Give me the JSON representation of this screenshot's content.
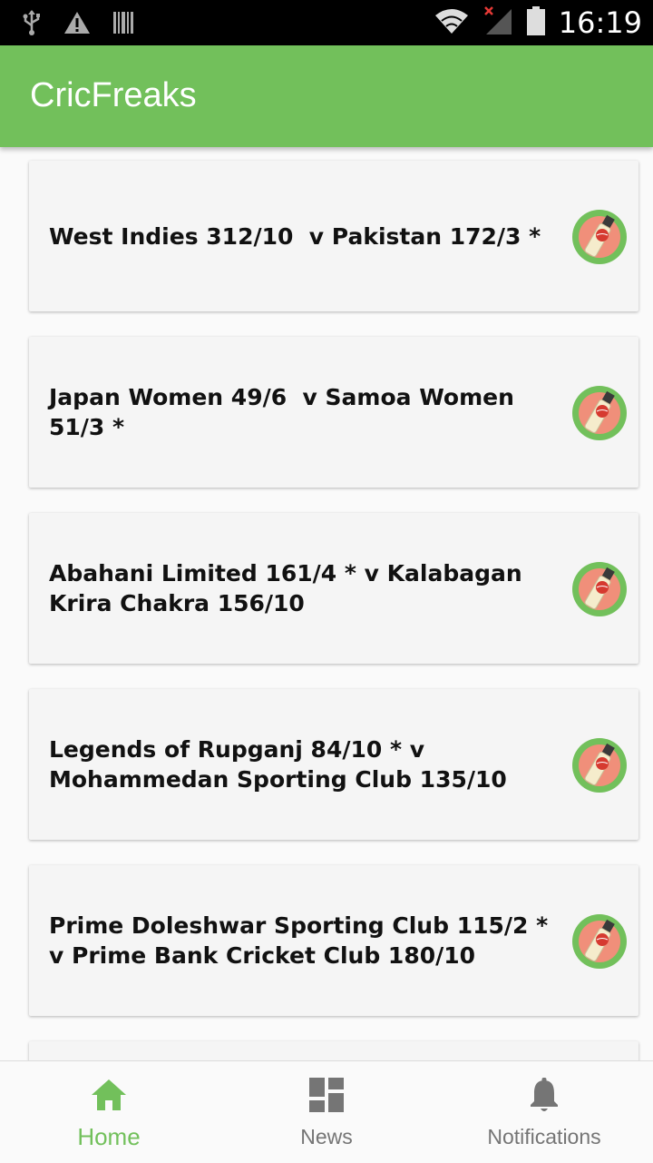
{
  "status_bar": {
    "time": "16:19",
    "icons": [
      "usb-icon",
      "warning-icon",
      "barcode-icon",
      "wifi-icon",
      "signal-icon",
      "battery-icon"
    ]
  },
  "app_bar": {
    "title": "CricFreaks"
  },
  "matches": [
    {
      "text": "West Indies 312/10  v Pakistan 172/3 *"
    },
    {
      "text": "Japan Women 49/6  v Samoa Women 51/3 *"
    },
    {
      "text": "Abahani Limited 161/4 * v Kalabagan Krira Chakra 156/10"
    },
    {
      "text": "Legends of Rupganj 84/10 * v Mohammedan Sporting Club 135/10"
    },
    {
      "text": "Prime Doleshwar Sporting Club 115/2 * v Prime Bank Cricket Club 180/10"
    },
    {
      "text": ""
    }
  ],
  "bottom_nav": {
    "items": [
      {
        "label": "Home",
        "icon": "home-icon",
        "active": true
      },
      {
        "label": "News",
        "icon": "dashboard-icon",
        "active": false
      },
      {
        "label": "Notifications",
        "icon": "bell-icon",
        "active": false
      }
    ]
  },
  "colors": {
    "primary": "#72c05b",
    "status_bar": "#000000",
    "card": "#f5f5f5",
    "nav_inactive": "#757575"
  }
}
